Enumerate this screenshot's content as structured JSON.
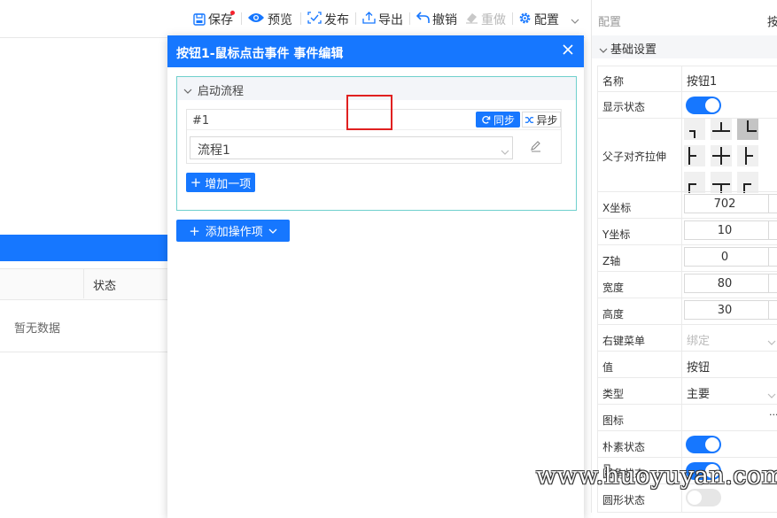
{
  "toolbar": {
    "save": "保存",
    "preview": "预览",
    "publish": "发布",
    "export": "导出",
    "undo": "撤销",
    "redo": "重做",
    "config": "配置"
  },
  "background": {
    "column_status": "状态",
    "empty_text": "暂无数据"
  },
  "dialog": {
    "title": "按钮1-鼠标点击事件 事件编辑",
    "flow_section": "启动流程",
    "item_number": "#1",
    "sync_label": "同步",
    "async_label": "异步",
    "flow_value": "流程1",
    "add_item_label": "增加一项",
    "add_operation_label": "添加操作项"
  },
  "panel": {
    "title": "配置",
    "tab_partial": "按",
    "section": "基础设置",
    "props": {
      "name_label": "名称",
      "name_value": "按钮1",
      "visible_label": "显示状态",
      "visible_on": true,
      "align_label": "父子对齐拉伸",
      "x_label": "X坐标",
      "x_value": "702",
      "y_label": "Y坐标",
      "y_value": "10",
      "z_label": "Z轴",
      "z_value": "0",
      "width_label": "宽度",
      "width_value": "80",
      "height_label": "高度",
      "height_value": "30",
      "context_menu_label": "右键菜单",
      "context_menu_placeholder": "绑定",
      "value_label": "值",
      "value_value": "按钮",
      "type_label": "类型",
      "type_value": "主要",
      "icon_label": "图标",
      "icon_more": "···",
      "plain_label": "朴素状态",
      "plain_on": true,
      "round_label": "圆角状态",
      "round_on": true,
      "circle_label": "圆形状态",
      "circle_on": false
    }
  },
  "watermark": "www.huoyuyan.com",
  "colors": {
    "primary": "#1677ff",
    "highlight_border": "#e02020",
    "teal_border": "#6fd0cd"
  }
}
